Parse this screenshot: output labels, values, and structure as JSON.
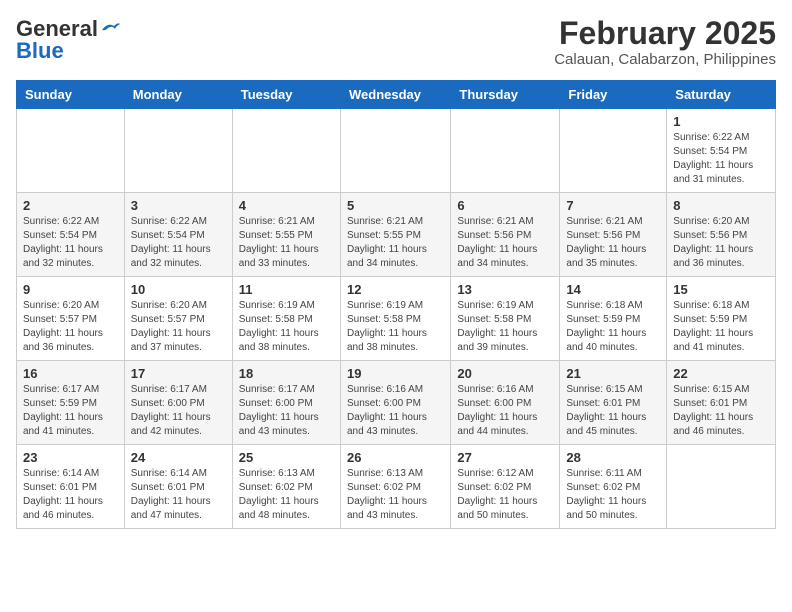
{
  "header": {
    "logo_line1_general": "General",
    "logo_line1_blue": "Blue",
    "title": "February 2025",
    "subtitle": "Calauan, Calabarzon, Philippines"
  },
  "calendar": {
    "days_of_week": [
      "Sunday",
      "Monday",
      "Tuesday",
      "Wednesday",
      "Thursday",
      "Friday",
      "Saturday"
    ],
    "weeks": [
      [
        {
          "day": "",
          "info": ""
        },
        {
          "day": "",
          "info": ""
        },
        {
          "day": "",
          "info": ""
        },
        {
          "day": "",
          "info": ""
        },
        {
          "day": "",
          "info": ""
        },
        {
          "day": "",
          "info": ""
        },
        {
          "day": "1",
          "info": "Sunrise: 6:22 AM\nSunset: 5:54 PM\nDaylight: 11 hours\nand 31 minutes."
        }
      ],
      [
        {
          "day": "2",
          "info": "Sunrise: 6:22 AM\nSunset: 5:54 PM\nDaylight: 11 hours\nand 32 minutes."
        },
        {
          "day": "3",
          "info": "Sunrise: 6:22 AM\nSunset: 5:54 PM\nDaylight: 11 hours\nand 32 minutes."
        },
        {
          "day": "4",
          "info": "Sunrise: 6:21 AM\nSunset: 5:55 PM\nDaylight: 11 hours\nand 33 minutes."
        },
        {
          "day": "5",
          "info": "Sunrise: 6:21 AM\nSunset: 5:55 PM\nDaylight: 11 hours\nand 34 minutes."
        },
        {
          "day": "6",
          "info": "Sunrise: 6:21 AM\nSunset: 5:56 PM\nDaylight: 11 hours\nand 34 minutes."
        },
        {
          "day": "7",
          "info": "Sunrise: 6:21 AM\nSunset: 5:56 PM\nDaylight: 11 hours\nand 35 minutes."
        },
        {
          "day": "8",
          "info": "Sunrise: 6:20 AM\nSunset: 5:56 PM\nDaylight: 11 hours\nand 36 minutes."
        }
      ],
      [
        {
          "day": "9",
          "info": "Sunrise: 6:20 AM\nSunset: 5:57 PM\nDaylight: 11 hours\nand 36 minutes."
        },
        {
          "day": "10",
          "info": "Sunrise: 6:20 AM\nSunset: 5:57 PM\nDaylight: 11 hours\nand 37 minutes."
        },
        {
          "day": "11",
          "info": "Sunrise: 6:19 AM\nSunset: 5:58 PM\nDaylight: 11 hours\nand 38 minutes."
        },
        {
          "day": "12",
          "info": "Sunrise: 6:19 AM\nSunset: 5:58 PM\nDaylight: 11 hours\nand 38 minutes."
        },
        {
          "day": "13",
          "info": "Sunrise: 6:19 AM\nSunset: 5:58 PM\nDaylight: 11 hours\nand 39 minutes."
        },
        {
          "day": "14",
          "info": "Sunrise: 6:18 AM\nSunset: 5:59 PM\nDaylight: 11 hours\nand 40 minutes."
        },
        {
          "day": "15",
          "info": "Sunrise: 6:18 AM\nSunset: 5:59 PM\nDaylight: 11 hours\nand 41 minutes."
        }
      ],
      [
        {
          "day": "16",
          "info": "Sunrise: 6:17 AM\nSunset: 5:59 PM\nDaylight: 11 hours\nand 41 minutes."
        },
        {
          "day": "17",
          "info": "Sunrise: 6:17 AM\nSunset: 6:00 PM\nDaylight: 11 hours\nand 42 minutes."
        },
        {
          "day": "18",
          "info": "Sunrise: 6:17 AM\nSunset: 6:00 PM\nDaylight: 11 hours\nand 43 minutes."
        },
        {
          "day": "19",
          "info": "Sunrise: 6:16 AM\nSunset: 6:00 PM\nDaylight: 11 hours\nand 43 minutes."
        },
        {
          "day": "20",
          "info": "Sunrise: 6:16 AM\nSunset: 6:00 PM\nDaylight: 11 hours\nand 44 minutes."
        },
        {
          "day": "21",
          "info": "Sunrise: 6:15 AM\nSunset: 6:01 PM\nDaylight: 11 hours\nand 45 minutes."
        },
        {
          "day": "22",
          "info": "Sunrise: 6:15 AM\nSunset: 6:01 PM\nDaylight: 11 hours\nand 46 minutes."
        }
      ],
      [
        {
          "day": "23",
          "info": "Sunrise: 6:14 AM\nSunset: 6:01 PM\nDaylight: 11 hours\nand 46 minutes."
        },
        {
          "day": "24",
          "info": "Sunrise: 6:14 AM\nSunset: 6:01 PM\nDaylight: 11 hours\nand 47 minutes."
        },
        {
          "day": "25",
          "info": "Sunrise: 6:13 AM\nSunset: 6:02 PM\nDaylight: 11 hours\nand 48 minutes."
        },
        {
          "day": "26",
          "info": "Sunrise: 6:13 AM\nSunset: 6:02 PM\nDaylight: 11 hours\nand 43 minutes."
        },
        {
          "day": "27",
          "info": "Sunrise: 6:12 AM\nSunset: 6:02 PM\nDaylight: 11 hours\nand 50 minutes."
        },
        {
          "day": "28",
          "info": "Sunrise: 6:11 AM\nSunset: 6:02 PM\nDaylight: 11 hours\nand 50 minutes."
        },
        {
          "day": "",
          "info": ""
        }
      ]
    ]
  }
}
